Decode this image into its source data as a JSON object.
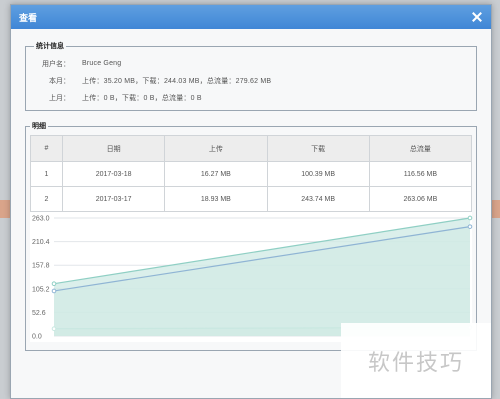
{
  "modal": {
    "title": "查看"
  },
  "stats": {
    "legend": "统计信息",
    "rows": [
      {
        "label": "用户名：",
        "value": "Bruce Geng"
      },
      {
        "label": "本月：",
        "value": "上传：35.20 MB，下载：244.03 MB，总流量：279.62 MB"
      },
      {
        "label": "上月：",
        "value": "上传：0 B，下载：0 B，总流量：0 B"
      }
    ]
  },
  "detail": {
    "legend": "明细",
    "columns": [
      "#",
      "日期",
      "上传",
      "下载",
      "总流量"
    ],
    "rows": [
      [
        "1",
        "2017-03-18",
        "16.27 MB",
        "100.39 MB",
        "116.56 MB"
      ],
      [
        "2",
        "2017-03-17",
        "18.93 MB",
        "243.74 MB",
        "263.06 MB"
      ]
    ]
  },
  "chart_data": {
    "type": "area",
    "y_ticks": [
      "263.0",
      "210.4",
      "157.8",
      "105.2",
      "52.6",
      "0.0"
    ],
    "ylim": [
      0,
      263.0
    ],
    "series": [
      {
        "values": [
          116.56,
          263.06
        ],
        "color": "#8fcfc4"
      },
      {
        "values": [
          100.39,
          243.74
        ],
        "color": "#8fb4d4"
      },
      {
        "values": [
          16.27,
          18.93
        ],
        "color": "#c9e8e1"
      }
    ],
    "colors": {
      "fill": "#cfe9e4",
      "line": "#86bfb4",
      "grid": "#e2e6ea"
    }
  },
  "watermark": "软件技巧"
}
